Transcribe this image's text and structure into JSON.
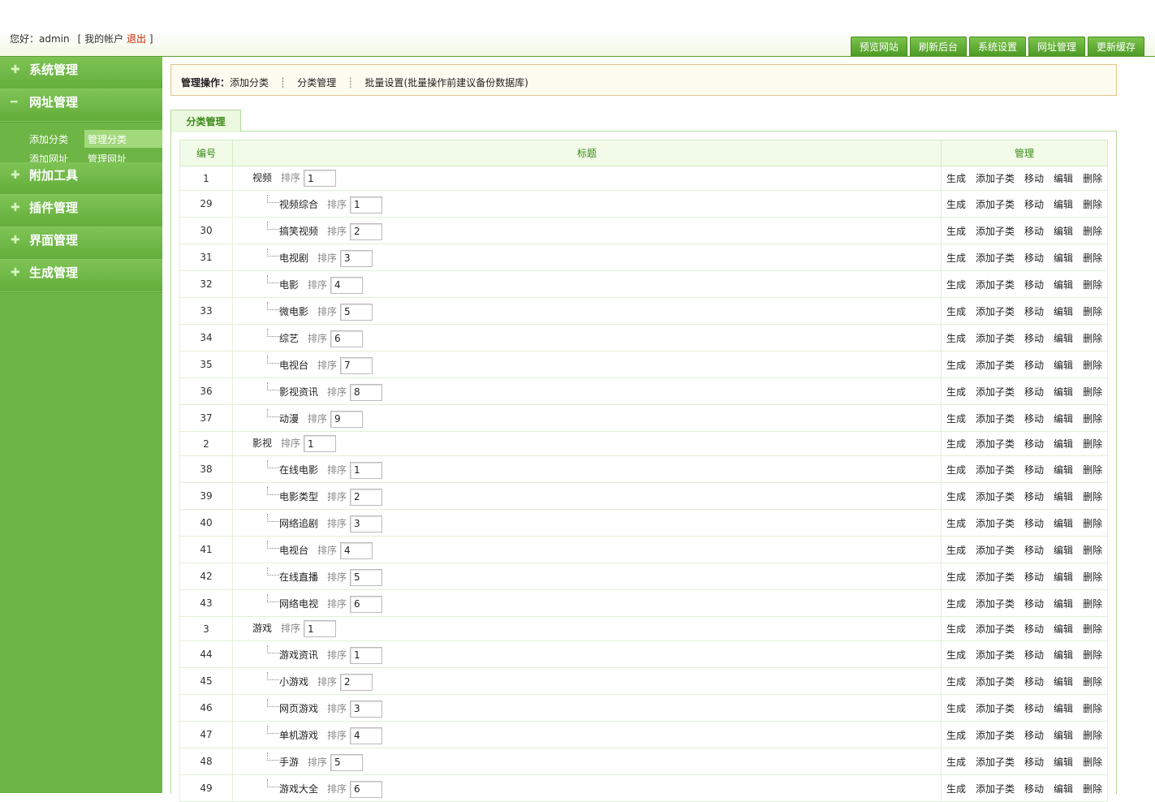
{
  "header": {
    "greeting_prefix": "您好：",
    "username": "admin",
    "account_open": "[",
    "my_account": "我的帐户",
    "logout": "退出",
    "account_close": "]",
    "nav": [
      "预览网站",
      "刷新后台",
      "系统设置",
      "网址管理",
      "更新缓存"
    ]
  },
  "sidebar": {
    "menus": [
      {
        "label": "系统管理",
        "icon": "plus-icon",
        "symbol": "✚"
      },
      {
        "label": "网址管理",
        "icon": "minus-icon",
        "symbol": "━",
        "expanded": true,
        "subitems": [
          [
            "添加分类",
            "管理分类"
          ],
          [
            "添加网址",
            "管理网址"
          ]
        ],
        "active": "管理分类"
      },
      {
        "label": "附加工具",
        "icon": "plus-icon",
        "symbol": "✚"
      },
      {
        "label": "插件管理",
        "icon": "plus-icon",
        "symbol": "✚"
      },
      {
        "label": "界面管理",
        "icon": "plus-icon",
        "symbol": "✚"
      },
      {
        "label": "生成管理",
        "icon": "plus-icon",
        "symbol": "✚"
      }
    ]
  },
  "opbar": {
    "label": "管理操作：",
    "links": [
      "添加分类",
      "分类管理",
      "批量设置(批量操作前建议备份数据库)"
    ],
    "separator": "┊"
  },
  "tab": {
    "label": "分类管理"
  },
  "table": {
    "headers": {
      "id": "编号",
      "title": "标题",
      "manage": "管理"
    },
    "sort_label": "排序",
    "ops": [
      "生成",
      "添加子类",
      "移动",
      "编辑",
      "删除"
    ],
    "rows": [
      {
        "id": "1",
        "name": "视频",
        "order": "1",
        "level": 0
      },
      {
        "id": "29",
        "name": "视频综合",
        "order": "1",
        "level": 1
      },
      {
        "id": "30",
        "name": "搞笑视频",
        "order": "2",
        "level": 1
      },
      {
        "id": "31",
        "name": "电视剧",
        "order": "3",
        "level": 1
      },
      {
        "id": "32",
        "name": "电影",
        "order": "4",
        "level": 1
      },
      {
        "id": "33",
        "name": "微电影",
        "order": "5",
        "level": 1
      },
      {
        "id": "34",
        "name": "综艺",
        "order": "6",
        "level": 1
      },
      {
        "id": "35",
        "name": "电视台",
        "order": "7",
        "level": 1
      },
      {
        "id": "36",
        "name": "影视资讯",
        "order": "8",
        "level": 1
      },
      {
        "id": "37",
        "name": "动漫",
        "order": "9",
        "level": 1
      },
      {
        "id": "2",
        "name": "影视",
        "order": "1",
        "level": 0
      },
      {
        "id": "38",
        "name": "在线电影",
        "order": "1",
        "level": 1
      },
      {
        "id": "39",
        "name": "电影类型",
        "order": "2",
        "level": 1
      },
      {
        "id": "40",
        "name": "网络追剧",
        "order": "3",
        "level": 1
      },
      {
        "id": "41",
        "name": "电视台",
        "order": "4",
        "level": 1
      },
      {
        "id": "42",
        "name": "在线直播",
        "order": "5",
        "level": 1
      },
      {
        "id": "43",
        "name": "网络电视",
        "order": "6",
        "level": 1
      },
      {
        "id": "3",
        "name": "游戏",
        "order": "1",
        "level": 0
      },
      {
        "id": "44",
        "name": "游戏资讯",
        "order": "1",
        "level": 1
      },
      {
        "id": "45",
        "name": "小游戏",
        "order": "2",
        "level": 1
      },
      {
        "id": "46",
        "name": "网页游戏",
        "order": "3",
        "level": 1
      },
      {
        "id": "47",
        "name": "单机游戏",
        "order": "4",
        "level": 1
      },
      {
        "id": "48",
        "name": "手游",
        "order": "5",
        "level": 1
      },
      {
        "id": "49",
        "name": "游戏大全",
        "order": "6",
        "level": 1
      }
    ]
  },
  "colors": {
    "sidebar_bg": "#6db544",
    "accent_green": "#3b8a18",
    "logout_red": "#cc2200",
    "opbar_border": "#e0c590"
  }
}
